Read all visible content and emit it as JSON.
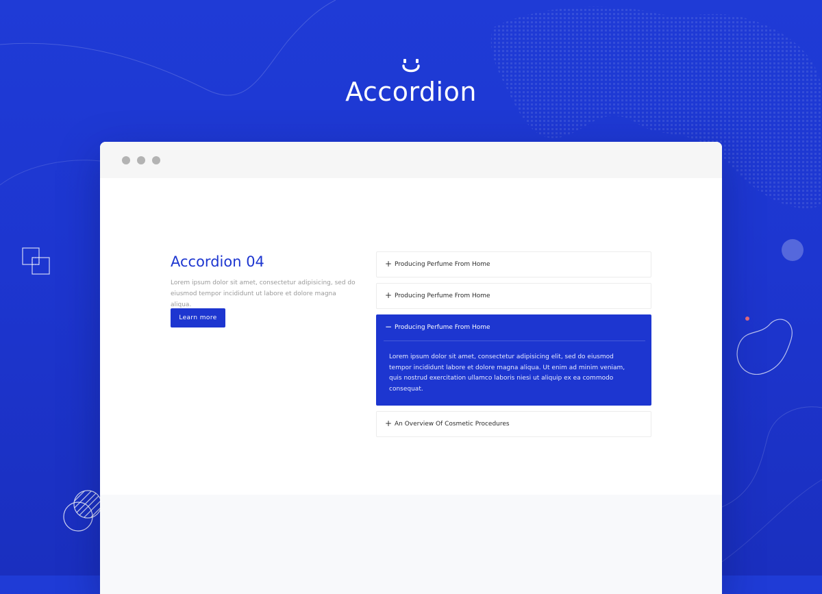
{
  "hero": {
    "logo_icon": "smile-logo-icon",
    "title": "Accordion"
  },
  "browser": {
    "window_dots": [
      "window-dot",
      "window-dot",
      "window-dot"
    ]
  },
  "section": {
    "title": "Accordion 04",
    "description": "Lorem ipsum dolor sit amet, consectetur adipisicing, sed do eiusmod tempor incididunt ut labore et dolore magna aliqua.",
    "button_label": "Learn more"
  },
  "accordion": {
    "items": [
      {
        "sign": "+",
        "label": "Producing Perfume From Home",
        "expanded": false
      },
      {
        "sign": "+",
        "label": "Producing Perfume From Home",
        "expanded": false
      },
      {
        "sign": "−",
        "label": "Producing Perfume From Home",
        "expanded": true,
        "body": "Lorem ipsum dolor sit amet, consectetur adipisicing elit, sed do eiusmod tempor incididunt labore et dolore magna aliqua. Ut enim ad minim veniam, quis nostrud exercitation ullamco laboris niesi ut aliquip ex ea commodo consequat."
      },
      {
        "sign": "+",
        "label": "An Overview Of Cosmetic Procedures",
        "expanded": false
      }
    ]
  },
  "colors": {
    "brand_blue": "#1d36d0",
    "page_background": "#1f3bd6",
    "white": "#ffffff",
    "muted_text": "#9a9a9a"
  }
}
